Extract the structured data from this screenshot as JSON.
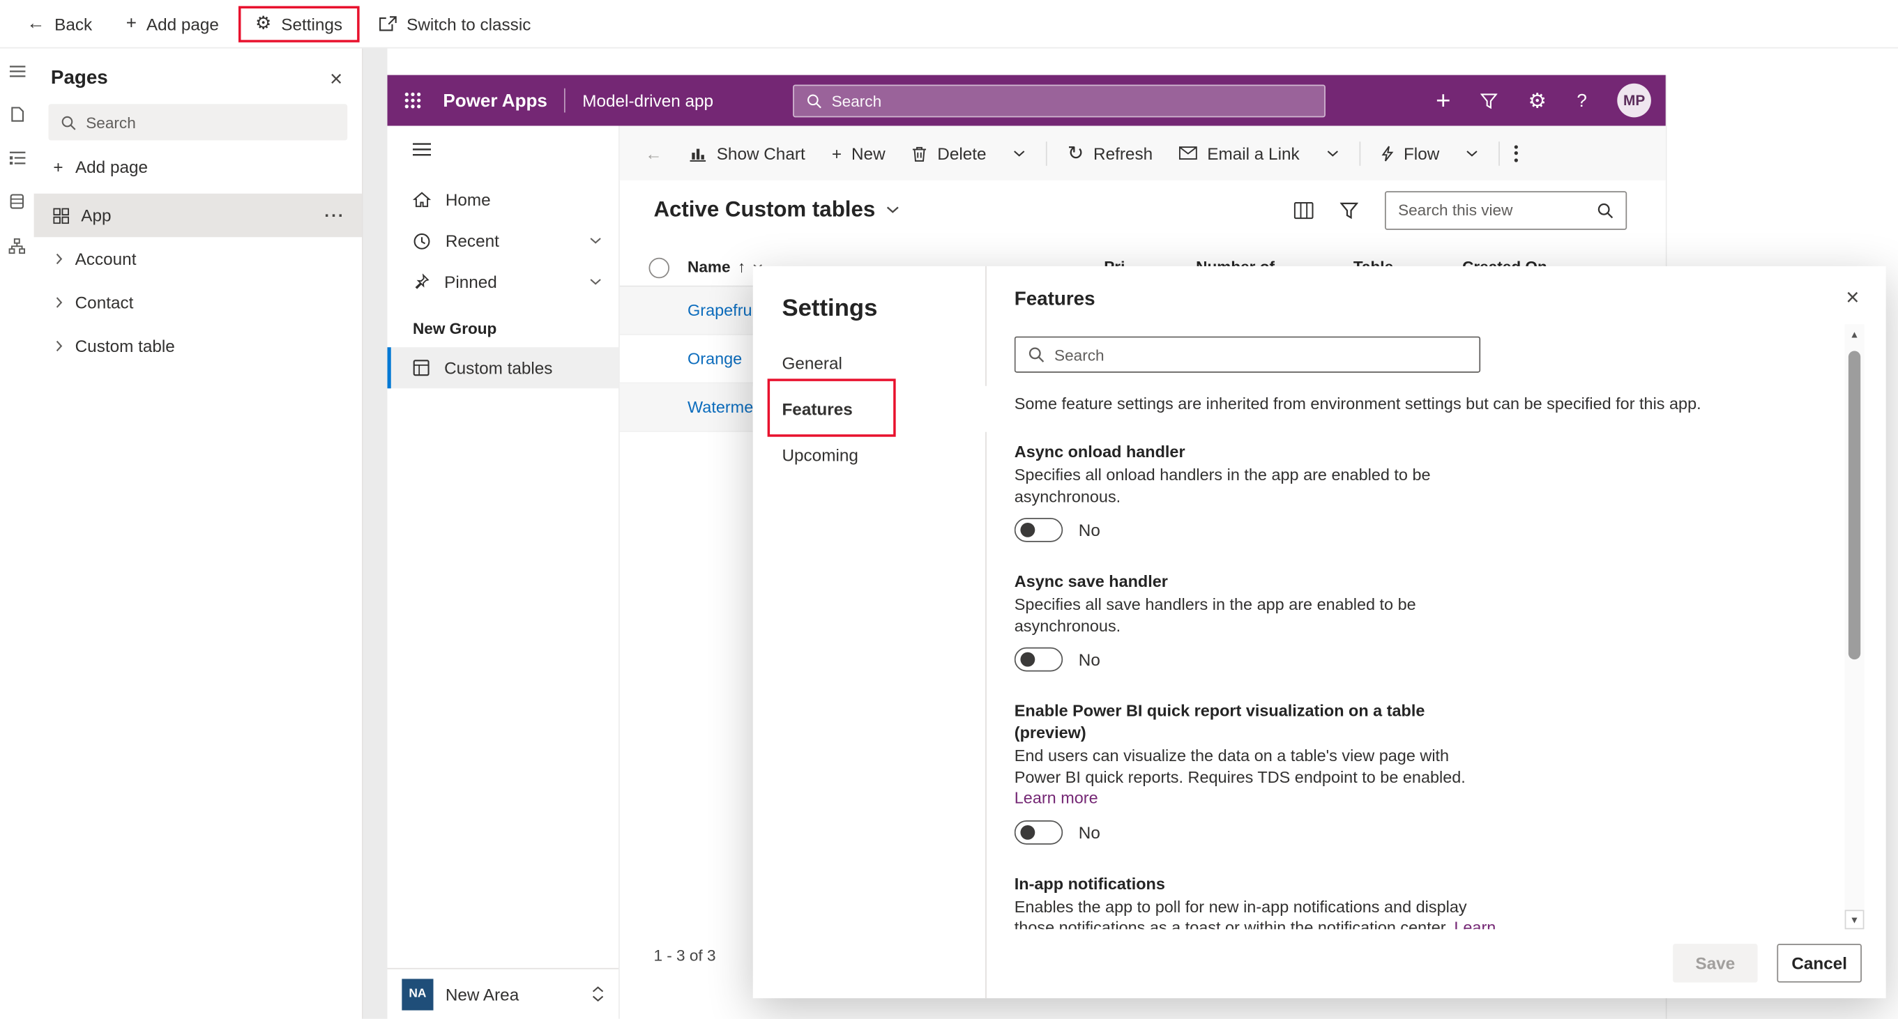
{
  "colors": {
    "brand_purple": "#742774",
    "accent_blue": "#0078d4",
    "annotation_red": "#e8112d",
    "link_purple": "#742774",
    "row_link_blue": "#0b6cbd"
  },
  "icons": {
    "back_arrow": "←",
    "plus": "+",
    "gear": "⚙",
    "question": "?",
    "close": "×",
    "refresh": "↻",
    "sort_asc": "↑",
    "more_horizontal": "···",
    "scroll_up": "▲",
    "scroll_down": "▼"
  },
  "toolbar": {
    "back": "Back",
    "add_page": "Add page",
    "settings": "Settings",
    "switch_to_classic": "Switch to classic"
  },
  "pages_panel": {
    "title": "Pages",
    "search_placeholder": "Search",
    "add_page": "Add page",
    "items": [
      {
        "label": "App"
      },
      {
        "label": "Account"
      },
      {
        "label": "Contact"
      },
      {
        "label": "Custom table"
      }
    ]
  },
  "app_header": {
    "brand": "Power Apps",
    "app_name": "Model-driven app",
    "search_placeholder": "Search",
    "avatar_initials": "MP"
  },
  "command_bar": {
    "show_chart": "Show Chart",
    "new": "New",
    "delete": "Delete",
    "refresh": "Refresh",
    "email_link": "Email a Link",
    "flow": "Flow"
  },
  "app_nav": {
    "home": "Home",
    "recent": "Recent",
    "pinned": "Pinned",
    "group_title": "New Group",
    "group_item": "Custom tables",
    "area_initials": "NA",
    "area_label": "New Area"
  },
  "view": {
    "title": "Active Custom tables",
    "search_placeholder": "Search this view",
    "columns": {
      "name": "Name",
      "col2": "Pri...",
      "col3": "Number of...",
      "col4": "Table...",
      "col5": "Created On..."
    },
    "rows": [
      {
        "name": "Grapefruit"
      },
      {
        "name": "Orange"
      },
      {
        "name": "Watermelon"
      }
    ],
    "record_count": "1 - 3 of 3"
  },
  "dialog": {
    "title": "Settings",
    "nav": {
      "general": "General",
      "features": "Features",
      "upcoming": "Upcoming"
    },
    "heading": "Features",
    "search_placeholder": "Search",
    "intro": "Some feature settings are inherited from environment settings but can be specified for this app.",
    "sections": [
      {
        "title": "Async onload handler",
        "description": "Specifies all onload handlers in the app are enabled to be asynchronous.",
        "value": "No"
      },
      {
        "title": "Async save handler",
        "description": "Specifies all save handlers in the app are enabled to be asynchronous.",
        "value": "No"
      },
      {
        "title": "Enable Power BI quick report visualization on a table (preview)",
        "description": "End users can visualize the data on a table's view page with Power BI quick reports. Requires TDS endpoint to be enabled.",
        "link": "Learn more",
        "value": "No"
      },
      {
        "title": "In-app notifications",
        "description": "Enables the app to poll for new in-app notifications and display those notifications as a toast or within the notification center.",
        "link": "Learn more"
      }
    ],
    "save": "Save",
    "cancel": "Cancel"
  }
}
